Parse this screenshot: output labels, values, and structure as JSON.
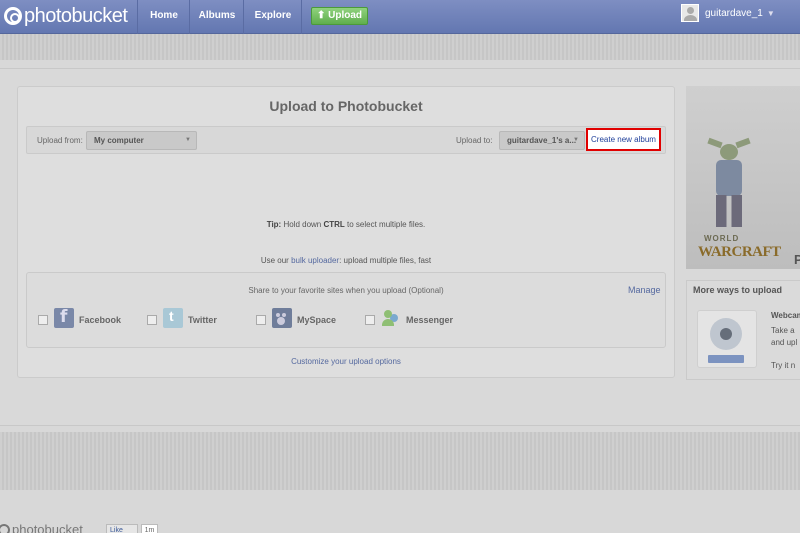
{
  "header": {
    "logo_text": "photobucket",
    "nav": [
      "Home",
      "Albums",
      "Explore"
    ],
    "upload_label": "⬆ Upload",
    "username": "guitardave_1"
  },
  "upload": {
    "title": "Upload to Photobucket",
    "upload_from_label": "Upload from:",
    "upload_from_value": "My computer",
    "upload_to_label": "Upload to:",
    "upload_to_value": "guitardave_1's a...",
    "create_album_label": "Create new album",
    "tip_prefix": "Tip:",
    "tip_text_1": " Hold down ",
    "tip_key": "CTRL",
    "tip_text_2": " to select multiple files.",
    "bulk_prefix": "Use our ",
    "bulk_link": "bulk uploader",
    "bulk_suffix": ": upload multiple files, fast",
    "share_title": "Share to your favorite sites when you upload (Optional)",
    "manage_label": "Manage",
    "share_sites": [
      "Facebook",
      "Twitter",
      "MySpace",
      "Messenger"
    ],
    "customize_label": "Customize your upload options"
  },
  "ad": {
    "game_top": "WORLD",
    "game_main": "WARCRAFT",
    "letter": "P"
  },
  "more_ways": {
    "title": "More ways to upload",
    "webcam_title": "Webcam",
    "line1": "Take a",
    "line2": "and upl",
    "try_link": "Try it n"
  },
  "footer": {
    "logo_text": "photobucket",
    "like_label": "Like",
    "like_count": "1m"
  },
  "colors": {
    "accent": "#6377b1",
    "upload_green": "#5fae4d",
    "highlight_red": "#e00000",
    "link": "#55699f"
  }
}
